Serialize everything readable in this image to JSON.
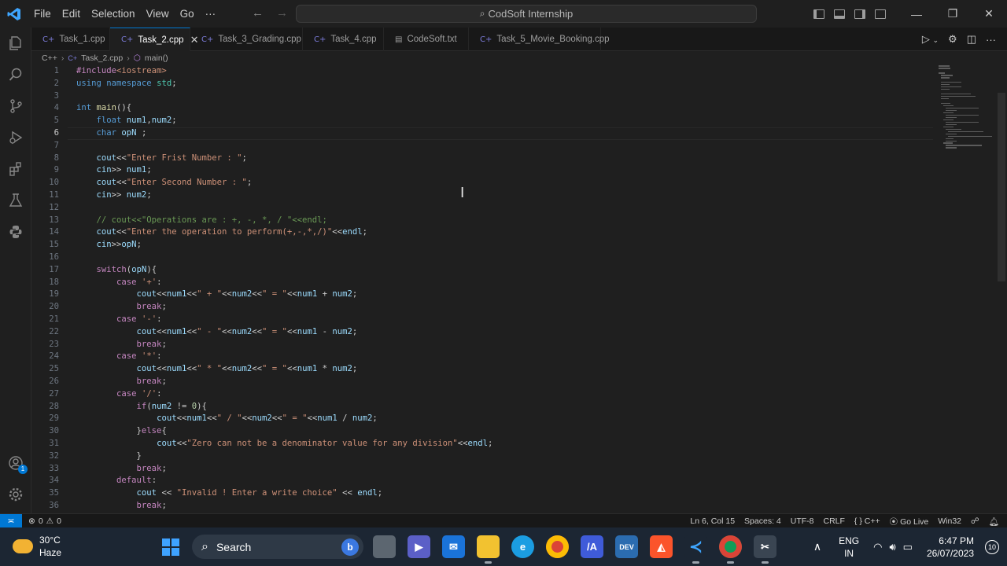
{
  "titlebar": {
    "menu": [
      "File",
      "Edit",
      "Selection",
      "View",
      "Go",
      "···"
    ],
    "command_center": "CodSoft Internship"
  },
  "tabs": [
    {
      "label": "Task_1.cpp",
      "icon": "cpp-icon",
      "active": false
    },
    {
      "label": "Task_2.cpp",
      "icon": "cpp-icon",
      "active": true
    },
    {
      "label": "Task_3_Grading.cpp",
      "icon": "cpp-icon",
      "active": false
    },
    {
      "label": "Task_4.cpp",
      "icon": "cpp-icon",
      "active": false
    },
    {
      "label": "CodeSoft.txt",
      "icon": "text-file-icon",
      "active": false
    },
    {
      "label": "Task_5_Movie_Booking.cpp",
      "icon": "cpp-icon",
      "active": false
    }
  ],
  "breadcrumb": {
    "lang": "C++",
    "file": "Task_2.cpp",
    "symbol": "main()"
  },
  "editor": {
    "current_line": 6,
    "lines": [
      {
        "n": "1",
        "text": "#include<iostream>"
      },
      {
        "n": "2",
        "text": "using namespace std;"
      },
      {
        "n": "3",
        "text": ""
      },
      {
        "n": "4",
        "text": "int main(){"
      },
      {
        "n": "5",
        "text": "    float num1,num2;"
      },
      {
        "n": "6",
        "text": "    char opN ;"
      },
      {
        "n": "7",
        "text": ""
      },
      {
        "n": "8",
        "text": "    cout<<\"Enter Frist Number : \";"
      },
      {
        "n": "9",
        "text": "    cin>> num1;"
      },
      {
        "n": "10",
        "text": "    cout<<\"Enter Second Number : \";"
      },
      {
        "n": "11",
        "text": "    cin>> num2;"
      },
      {
        "n": "12",
        "text": ""
      },
      {
        "n": "13",
        "text": "    // cout<<\"Operations are : +, -, *, / \"<<endl;"
      },
      {
        "n": "14",
        "text": "    cout<<\"Enter the operation to perform(+,-,*,/)\"<<endl;"
      },
      {
        "n": "15",
        "text": "    cin>>opN;"
      },
      {
        "n": "16",
        "text": ""
      },
      {
        "n": "17",
        "text": "    switch(opN){"
      },
      {
        "n": "18",
        "text": "        case '+':"
      },
      {
        "n": "19",
        "text": "            cout<<num1<<\" + \"<<num2<<\" = \"<<num1 + num2;"
      },
      {
        "n": "20",
        "text": "            break;"
      },
      {
        "n": "21",
        "text": "        case '-':"
      },
      {
        "n": "22",
        "text": "            cout<<num1<<\" - \"<<num2<<\" = \"<<num1 - num2;"
      },
      {
        "n": "23",
        "text": "            break;"
      },
      {
        "n": "24",
        "text": "        case '*':"
      },
      {
        "n": "25",
        "text": "            cout<<num1<<\" * \"<<num2<<\" = \"<<num1 * num2;"
      },
      {
        "n": "26",
        "text": "            break;"
      },
      {
        "n": "27",
        "text": "        case '/':"
      },
      {
        "n": "28",
        "text": "            if(num2 != 0){"
      },
      {
        "n": "29",
        "text": "                cout<<num1<<\" / \"<<num2<<\" = \"<<num1 / num2;"
      },
      {
        "n": "30",
        "text": "            }else{"
      },
      {
        "n": "31",
        "text": "                cout<<\"Zero can not be a denominator value for any division\"<<endl;"
      },
      {
        "n": "32",
        "text": "            }"
      },
      {
        "n": "33",
        "text": "            break;"
      },
      {
        "n": "34",
        "text": "        default:"
      },
      {
        "n": "35",
        "text": "            cout << \"Invalid ! Enter a write choice\" << endl;"
      },
      {
        "n": "36",
        "text": "            break;"
      }
    ]
  },
  "statusbar": {
    "errors": "0",
    "warnings": "0",
    "position": "Ln 6, Col 15",
    "spaces": "Spaces: 4",
    "encoding": "UTF-8",
    "eol": "CRLF",
    "language": "C++",
    "go_live": "Go Live",
    "platform": "Win32"
  },
  "taskbar": {
    "temperature": "30°C",
    "condition": "Haze",
    "search_label": "Search",
    "lang_line1": "ENG",
    "lang_line2": "IN",
    "time": "6:47 PM",
    "date": "26/07/2023",
    "notifications": "10"
  },
  "colors": {
    "keyword": "#569cd6",
    "control": "#c586c0",
    "string": "#ce9178",
    "comment": "#6a9955",
    "function": "#dcdcaa",
    "type": "#4ec9b0",
    "variable": "#9cdcfe",
    "number": "#b5cea8",
    "accent": "#0078d4"
  }
}
